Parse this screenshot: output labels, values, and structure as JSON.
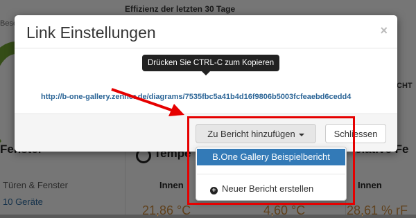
{
  "background": {
    "header": "Effizienz der letzten 30 Tage",
    "left_fragment": "Bese",
    "right_fragment": "CHT",
    "section_left": "Fenster",
    "section_mid": "Tempe",
    "section_right": "elative Fe",
    "doors_label": "Türen & Fenster",
    "devices_label": "10 Geräte",
    "innen_1": "Innen",
    "innen_2": "Innen",
    "value_1": "21,86 °C",
    "value_2": "4,60 °C",
    "value_3": "28,61 % rF"
  },
  "modal": {
    "title": "Link Einstellungen",
    "close_symbol": "×",
    "tooltip": "Drücken Sie CTRL-C zum Kopieren",
    "link": "http://b-one-gallery.zenner.de/diagrams/7535fbc5a41b4d16f9806b5003fcfeaebd6cedd4",
    "add_button": "Zu Bericht hinzufügen",
    "close_button": "Schliessen"
  },
  "dropdown": {
    "items": [
      {
        "label": "B.One Gallery Beispielbericht",
        "active": true
      },
      {
        "label": "Neuer Bericht erstellen",
        "icon": "plus-circle-icon"
      }
    ]
  },
  "colors": {
    "accent": "#337ab7",
    "link": "#2a6496",
    "annotation": "#e60000"
  }
}
